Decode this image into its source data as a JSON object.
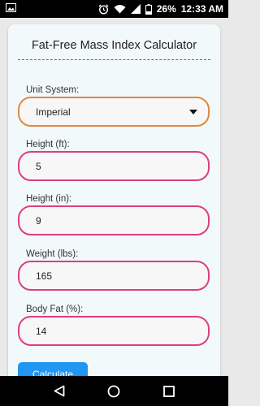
{
  "status_bar": {
    "battery": "26%",
    "time": "12:33 AM",
    "icons": [
      "image-icon",
      "alarm-icon",
      "wifi-icon",
      "signal-icon",
      "battery-icon"
    ]
  },
  "card": {
    "title": "Fat-Free Mass Index Calculator",
    "unit_system": {
      "label": "Unit System:",
      "value": "Imperial"
    },
    "height_ft": {
      "label": "Height (ft):",
      "value": "5"
    },
    "height_in": {
      "label": "Height (in):",
      "value": "9"
    },
    "weight": {
      "label": "Weight (lbs):",
      "value": "165"
    },
    "body_fat": {
      "label": "Body Fat (%):",
      "value": "14"
    },
    "calculate_label": "Calculate"
  },
  "colors": {
    "field_border": "#dc3f7c",
    "select_border": "#dd8a3c",
    "button": "#2196f3",
    "card_bg": "#f2f9fb"
  },
  "nav_bar": {
    "icons": [
      "back-icon",
      "home-icon",
      "recents-icon"
    ]
  }
}
